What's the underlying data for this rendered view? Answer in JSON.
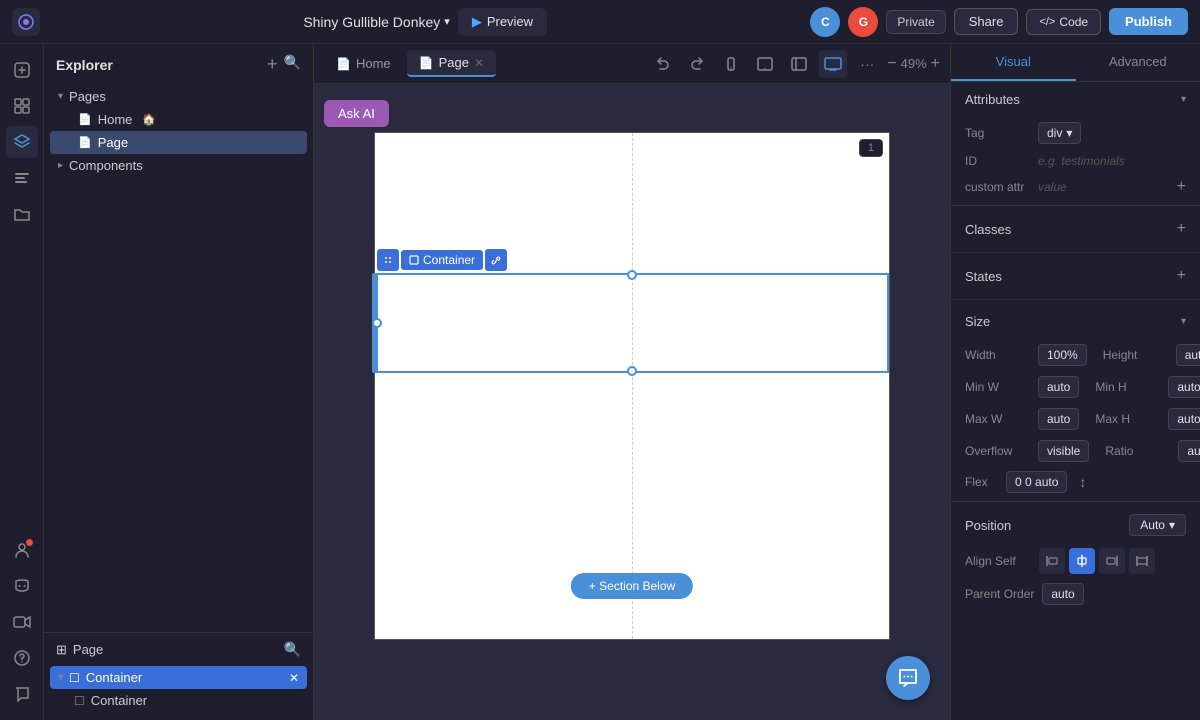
{
  "topbar": {
    "logo_icon": "◈",
    "project_name": "Shiny Gullible Donkey",
    "dropdown_icon": "▾",
    "preview_label": "Preview",
    "avatars": [
      {
        "initial": "C",
        "bg": "#4a90d9"
      },
      {
        "initial": "G",
        "bg": "#e74c3c"
      }
    ],
    "private_label": "Private",
    "share_label": "Share",
    "code_label": "Code",
    "code_icon": "</>",
    "publish_label": "Publish"
  },
  "sidebar_icons": {
    "icons": [
      "⊕",
      "⊞",
      "⬡",
      "✦",
      "📋",
      "👤",
      "🎮",
      "🎬",
      "?",
      "💬"
    ]
  },
  "explorer": {
    "title": "Explorer",
    "add_icon": "+",
    "search_icon": "🔍",
    "pages_label": "Pages",
    "pages_chevron": "▾",
    "home_label": "Home",
    "page_label": "Page",
    "components_label": "Components",
    "components_chevron": "▸"
  },
  "layer_panel": {
    "title": "Page",
    "layer_icon": "⊞",
    "search_icon": "🔍",
    "container_label": "Container",
    "container_child": "Container",
    "close_icon": "✕"
  },
  "canvas": {
    "home_tab": "Home",
    "page_tab": "Page",
    "close_icon": "✕",
    "zoom": "49%",
    "ask_ai": "Ask AI",
    "frame_no": "1",
    "add_section": "+ Section Below",
    "container_label": "Container",
    "link_icon": "🔗"
  },
  "right_panel": {
    "visual_tab": "Visual",
    "advanced_tab": "Advanced",
    "attributes_label": "Attributes",
    "tag_label": "Tag",
    "tag_value": "div",
    "tag_dropdown": "▾",
    "id_label": "ID",
    "id_placeholder": "e.g. testimonials",
    "custom_attr_label": "custom attr",
    "custom_attr_placeholder": "value",
    "add_attr_icon": "+",
    "classes_label": "Classes",
    "classes_add": "+",
    "states_label": "States",
    "states_add": "+",
    "size_label": "Size",
    "size_chevron": "▾",
    "width_label": "Width",
    "width_value": "100%",
    "height_label": "Height",
    "height_value": "auto",
    "min_w_label": "Min W",
    "min_w_value": "auto",
    "min_h_label": "Min H",
    "min_h_value": "auto",
    "max_w_label": "Max W",
    "max_w_value": "auto",
    "max_h_label": "Max H",
    "max_h_value": "auto",
    "overflow_label": "Overflow",
    "overflow_value": "visible",
    "ratio_label": "Ratio",
    "ratio_value": "au...",
    "flex_label": "Flex",
    "flex_value": "0 0 auto",
    "flex_icon": "↕",
    "position_label": "Position",
    "position_value": "Auto",
    "position_dropdown": "▾",
    "align_self_label": "Align Self",
    "parent_order_label": "Parent Order",
    "parent_order_value": "auto"
  }
}
